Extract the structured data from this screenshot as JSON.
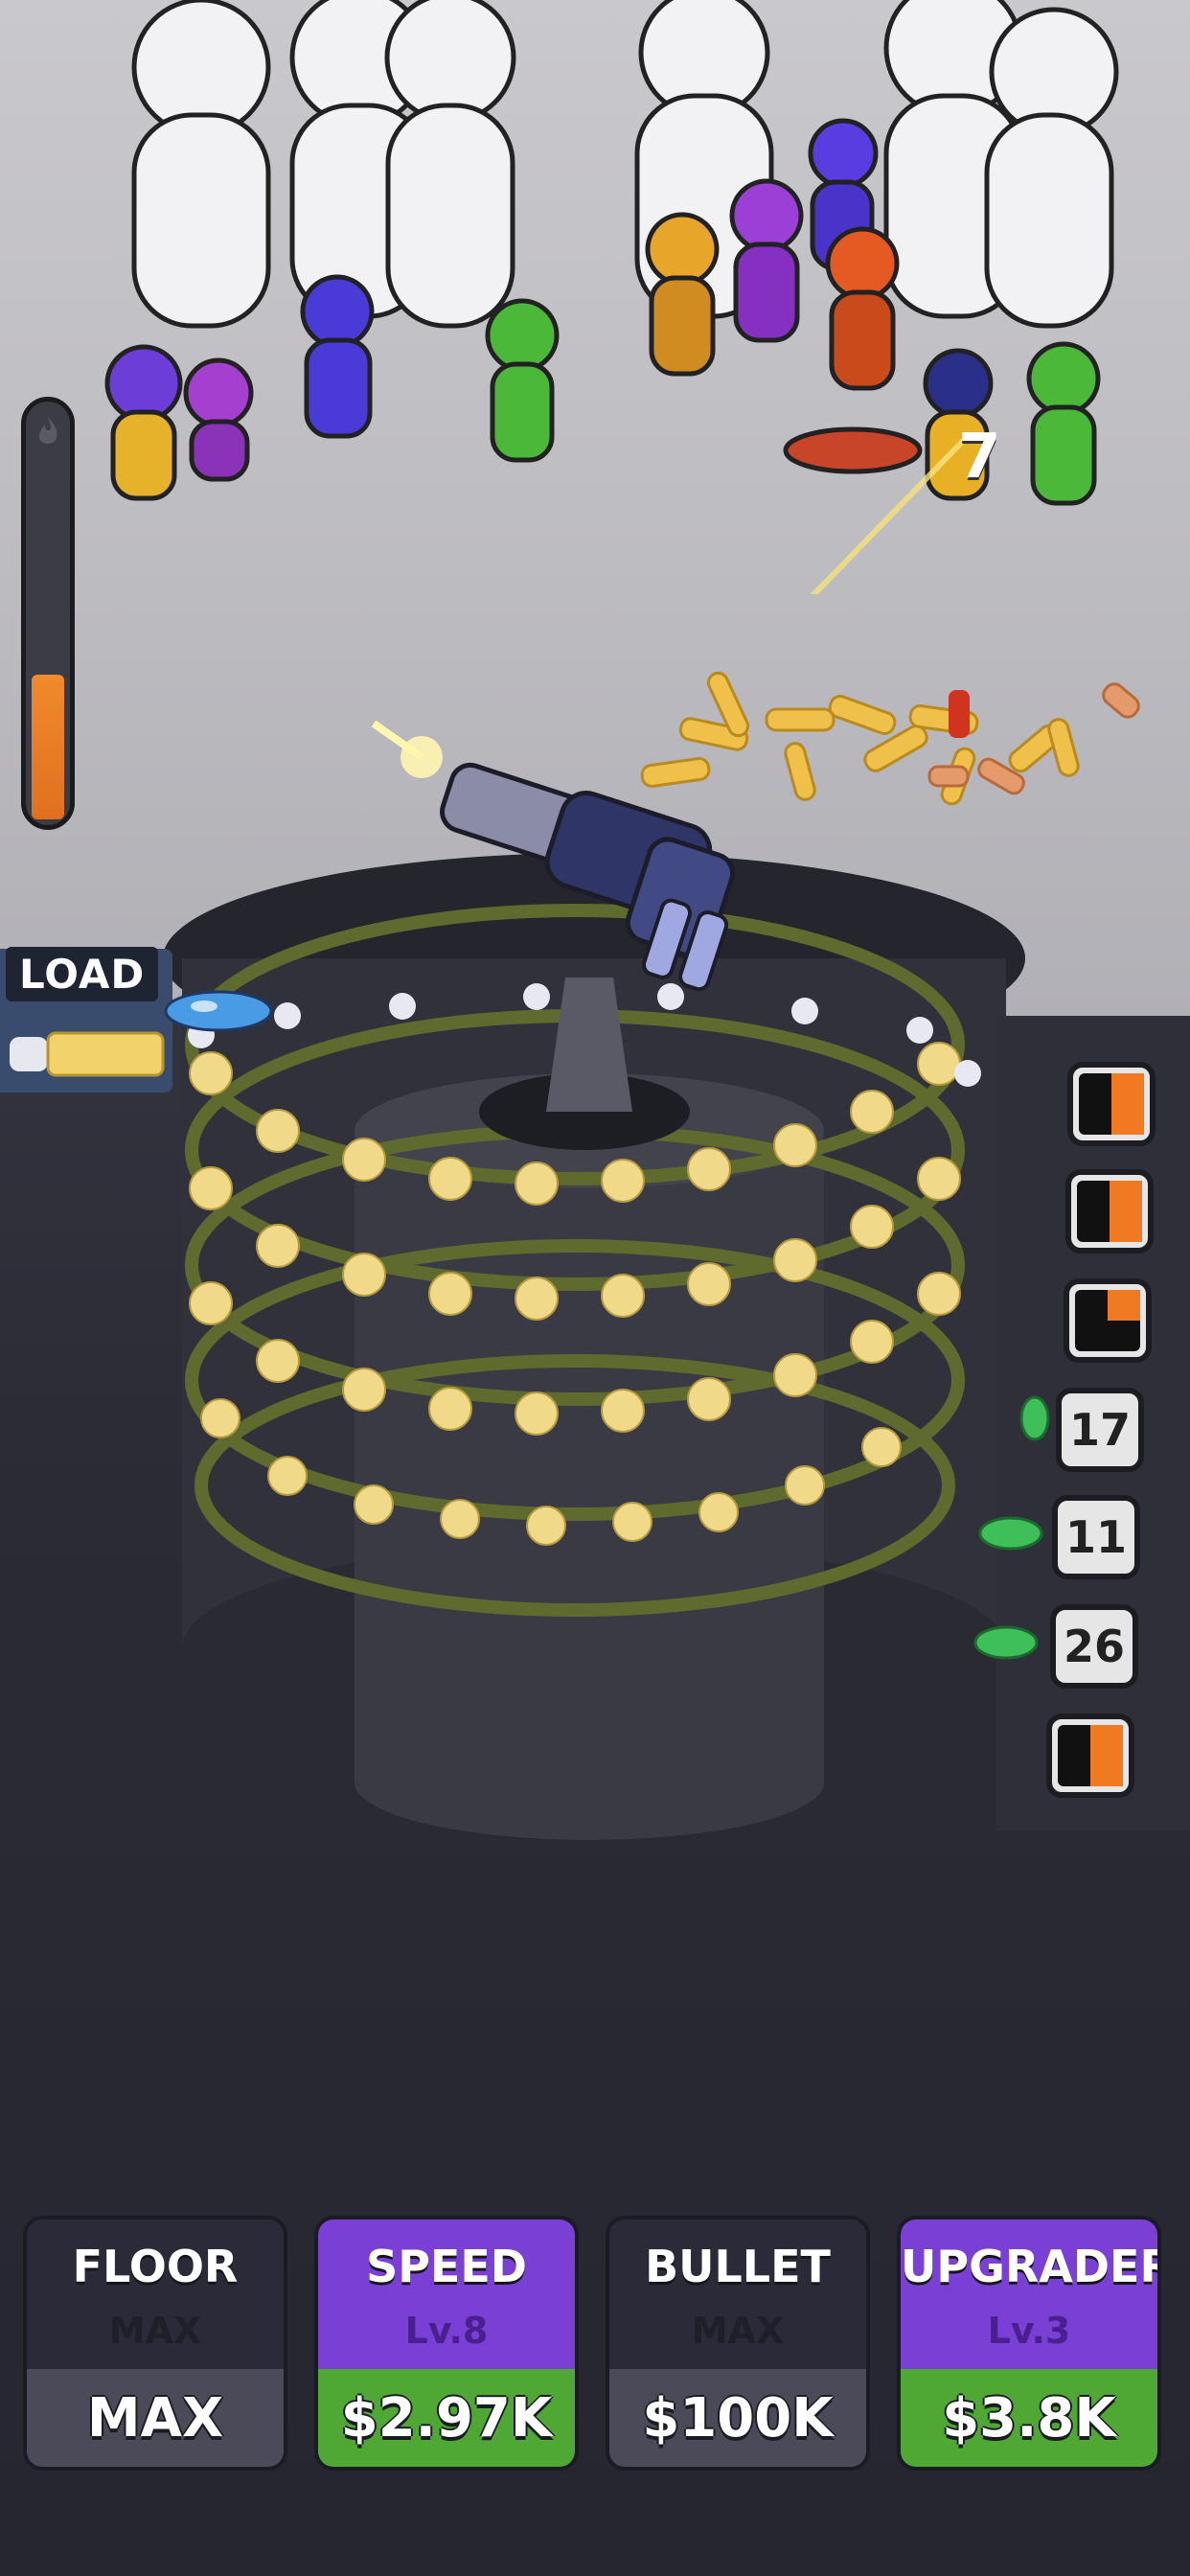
{
  "hud": {
    "load_label": "LOAD",
    "heat_meter": {
      "icon": "flame-icon",
      "level": 0.35,
      "color": "#f08a2c"
    },
    "damage_popup": "7"
  },
  "queue": {
    "slots": [
      {
        "type": "progress",
        "fill": 0.5
      },
      {
        "type": "progress",
        "fill": 0.5
      },
      {
        "type": "progress",
        "fill": 0.25
      },
      {
        "type": "count",
        "value": "17"
      },
      {
        "type": "count",
        "value": "11"
      },
      {
        "type": "count",
        "value": "26"
      },
      {
        "type": "progress",
        "fill": 0.5
      }
    ]
  },
  "upgrades": [
    {
      "id": "floor",
      "title": "FLOOR",
      "level": "MAX",
      "price": "MAX",
      "style": "gray"
    },
    {
      "id": "speed",
      "title": "SPEED",
      "level": "Lv.8",
      "price": "$2.97K",
      "style": "purple"
    },
    {
      "id": "bullet",
      "title": "BULLET",
      "level": "MAX",
      "price": "$100K",
      "style": "gray"
    },
    {
      "id": "upgrader",
      "title": "UPGRADER",
      "level": "Lv.3",
      "price": "$3.8K",
      "style": "purple"
    }
  ],
  "colors": {
    "accent_purple": "#7a3fd4",
    "price_green": "#4fa833",
    "heat_orange": "#f08a2c",
    "bullet_yellow": "#f2d36b"
  }
}
